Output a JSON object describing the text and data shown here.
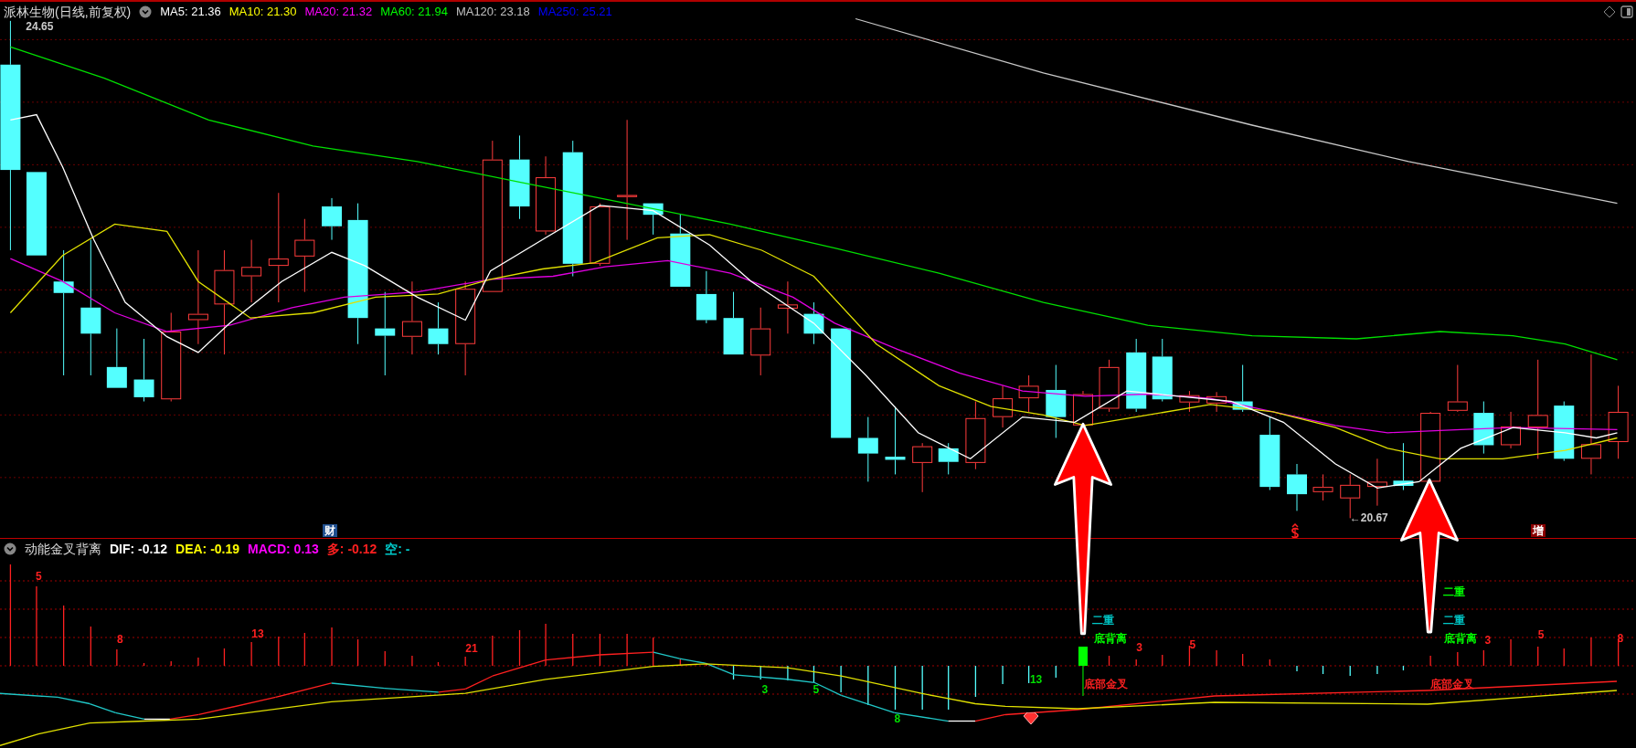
{
  "upper_panel": {
    "title": "派林生物(日线,前复权)",
    "indicators": [
      {
        "label": "MA5: 21.36",
        "color": "#ffffff"
      },
      {
        "label": "MA10: 21.30",
        "color": "#ffff00"
      },
      {
        "label": "MA20: 21.32",
        "color": "#ff00ff"
      },
      {
        "label": "MA60: 21.94",
        "color": "#00ff00"
      },
      {
        "label": "MA120: 23.18",
        "color": "#c0c0c0"
      },
      {
        "label": "MA250: 25.21",
        "color": "#0000ff"
      }
    ],
    "high_label": "24.65",
    "low_label": "←20.67",
    "markers": [
      {
        "kind": "badge",
        "text": "财",
        "color": "#1f4f8f"
      },
      {
        "kind": "dollar"
      },
      {
        "kind": "badge",
        "text": "增",
        "color": "#8b0000"
      }
    ]
  },
  "lower_panel": {
    "title": "动能金叉背离",
    "indicators": [
      {
        "label": "DIF: -0.12",
        "color": "#ffffff"
      },
      {
        "label": "DEA: -0.19",
        "color": "#ffff00"
      },
      {
        "label": "MACD: 0.13",
        "color": "#ff00ff"
      },
      {
        "label": "多: -0.12",
        "color": "#ff2020"
      },
      {
        "label": "空: -",
        "color": "#00c8c8"
      }
    ],
    "labels": [
      {
        "text": "5",
        "color": "#ff2020"
      },
      {
        "text": "8",
        "color": "#ff2020"
      },
      {
        "text": "13",
        "color": "#ff2020"
      },
      {
        "text": "21",
        "color": "#ff2020"
      },
      {
        "text": "3",
        "color": "#00e000"
      },
      {
        "text": "5",
        "color": "#00e000"
      },
      {
        "text": "8",
        "color": "#00e000"
      },
      {
        "text": "13",
        "color": "#00e000"
      },
      {
        "text": "二重",
        "color": "#00c8c8"
      },
      {
        "text": "底背离",
        "color": "#00ff00"
      },
      {
        "text": "3",
        "color": "#ff2020"
      },
      {
        "text": "5",
        "color": "#ff2020"
      },
      {
        "text": "底部金叉",
        "color": "#ff2020"
      },
      {
        "text": "二重",
        "color": "#00ff00"
      },
      {
        "text": "二重",
        "color": "#00c8c8"
      },
      {
        "text": "底背离",
        "color": "#00ff00"
      },
      {
        "text": "3",
        "color": "#ff2020"
      },
      {
        "text": "5",
        "color": "#ff2020"
      },
      {
        "text": "8",
        "color": "#ff2020"
      },
      {
        "text": "底部金叉",
        "color": "#ff2020"
      }
    ]
  }
}
